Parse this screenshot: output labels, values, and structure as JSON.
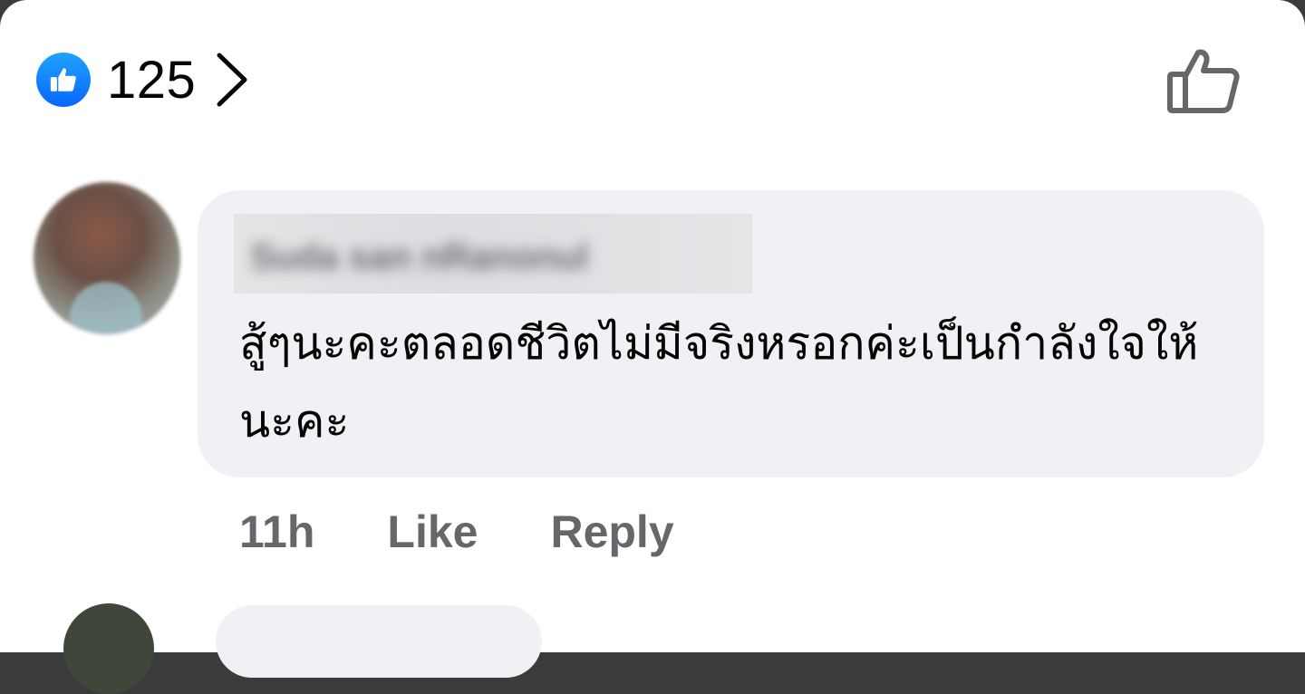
{
  "reactions": {
    "count": "125",
    "reaction_icon": "thumbs-up-icon",
    "chevron_icon": "chevron-right-icon",
    "like_action_icon": "thumbs-up-outline-icon",
    "badge_color": "#0866ff"
  },
  "comment": {
    "author_name": "Suda san nRanonul",
    "text": "สู้ๆนะคะตลอดชีวิตไม่มีจริงหรอกค่ะเป็นกำลังใจให้นะคะ",
    "time": "11h",
    "like_label": "Like",
    "reply_label": "Reply"
  },
  "colors": {
    "bubble": "#eff1f4",
    "meta_text": "#65676b",
    "primary_text": "#050505"
  }
}
